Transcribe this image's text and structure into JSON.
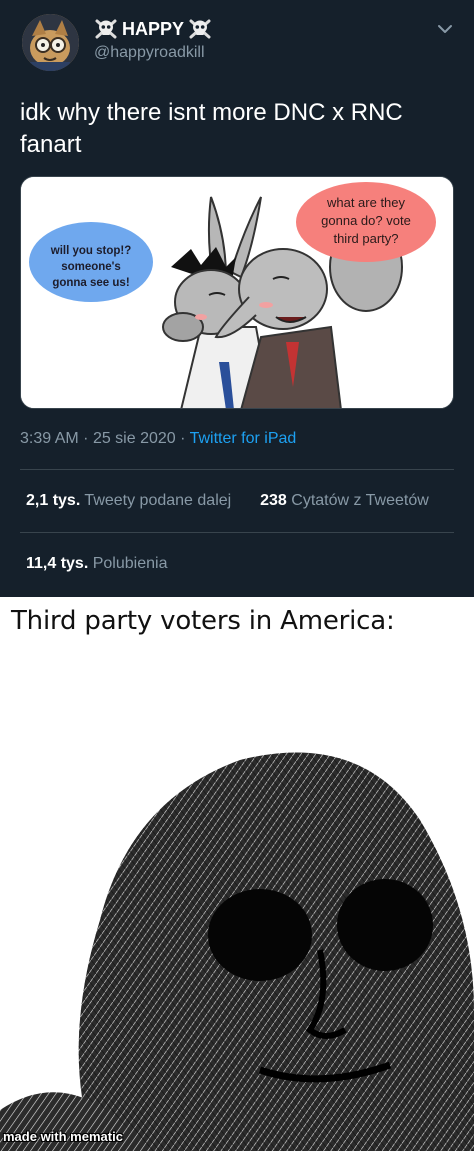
{
  "tweet": {
    "display_name": "HAPPY",
    "handle": "@happyroadkill",
    "text": "idk why there isnt more DNC x RNC fanart",
    "time": "3:39 AM",
    "date": "25 sie 2020",
    "source": "Twitter for iPad",
    "retweets_count": "2,1 tys.",
    "retweets_label": "Tweety podane dalej",
    "quotes_count": "238",
    "quotes_label": "Cytatów z Tweetów",
    "likes_count": "11,4 tys.",
    "likes_label": "Polubienia",
    "media": {
      "bubble_left": [
        "will you stop!?",
        "someone's",
        "gonna see us!"
      ],
      "bubble_right": [
        "what are they",
        "gonna do? vote",
        "third party?"
      ]
    }
  },
  "meme": {
    "caption": "Third party voters in America:",
    "watermark": "made with mematic"
  },
  "colors": {
    "tweet_bg": "#15202b",
    "secondary_text": "#8899a6",
    "link": "#1da1f2",
    "bubble_blue": "#6fa8ee",
    "bubble_pink": "#f6807c"
  }
}
